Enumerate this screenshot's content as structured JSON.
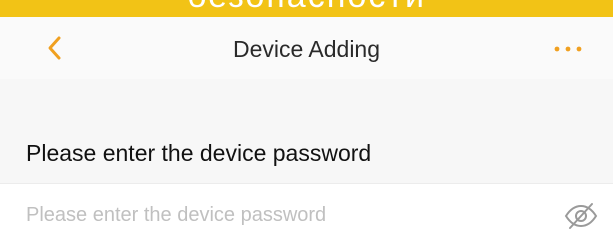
{
  "banner": {
    "text": "безопасности"
  },
  "nav": {
    "title": "Device Adding",
    "back_icon": "chevron-left-icon",
    "more_icon": "more-dots-icon",
    "accent_color": "#f0a020"
  },
  "form": {
    "prompt_label": "Please enter the device password",
    "password": {
      "value": "",
      "placeholder": "Please enter the device password",
      "visibility_icon": "eye-off-icon"
    }
  }
}
